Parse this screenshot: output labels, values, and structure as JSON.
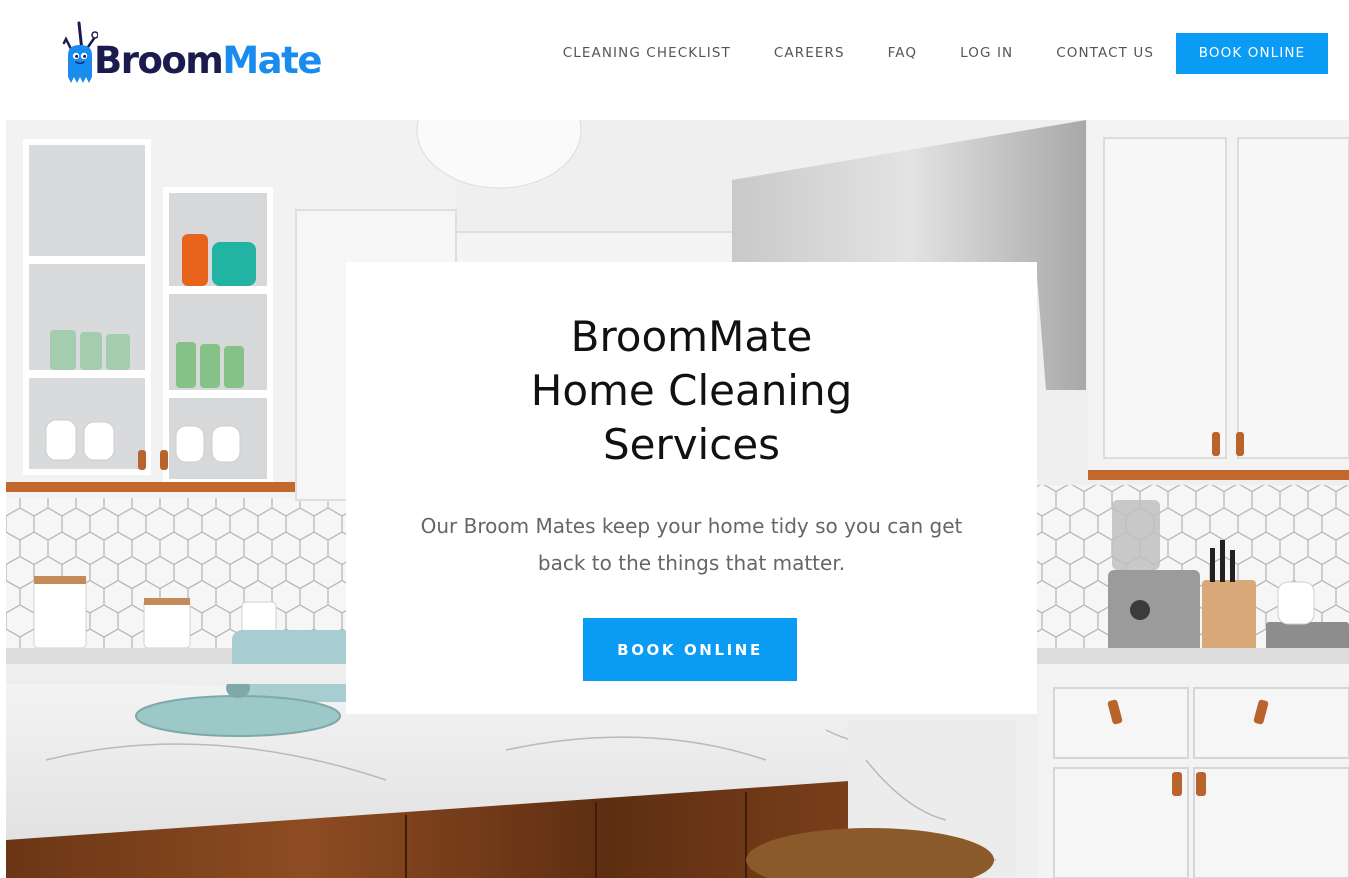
{
  "brand": {
    "name_part1": "Broom",
    "name_part2": "Mate",
    "color_dark": "#1c1b4d",
    "color_accent": "#1a8cf0",
    "mascot_icon": "broom-mascot-icon"
  },
  "nav": {
    "items": [
      {
        "label": "CLEANING CHECKLIST"
      },
      {
        "label": "CAREERS"
      },
      {
        "label": "FAQ"
      },
      {
        "label": "LOG IN"
      },
      {
        "label": "CONTACT US"
      }
    ],
    "cta_label": "BOOK ONLINE",
    "cta_color": "#0a9bf5"
  },
  "hero": {
    "image": "kitchen-photo",
    "title_lines": [
      "BroomMate",
      "Home Cleaning",
      "Services"
    ],
    "description": "Our Broom Mates keep your home tidy so you can get back to the things that matter.",
    "cta_label": "BOOK ONLINE"
  }
}
